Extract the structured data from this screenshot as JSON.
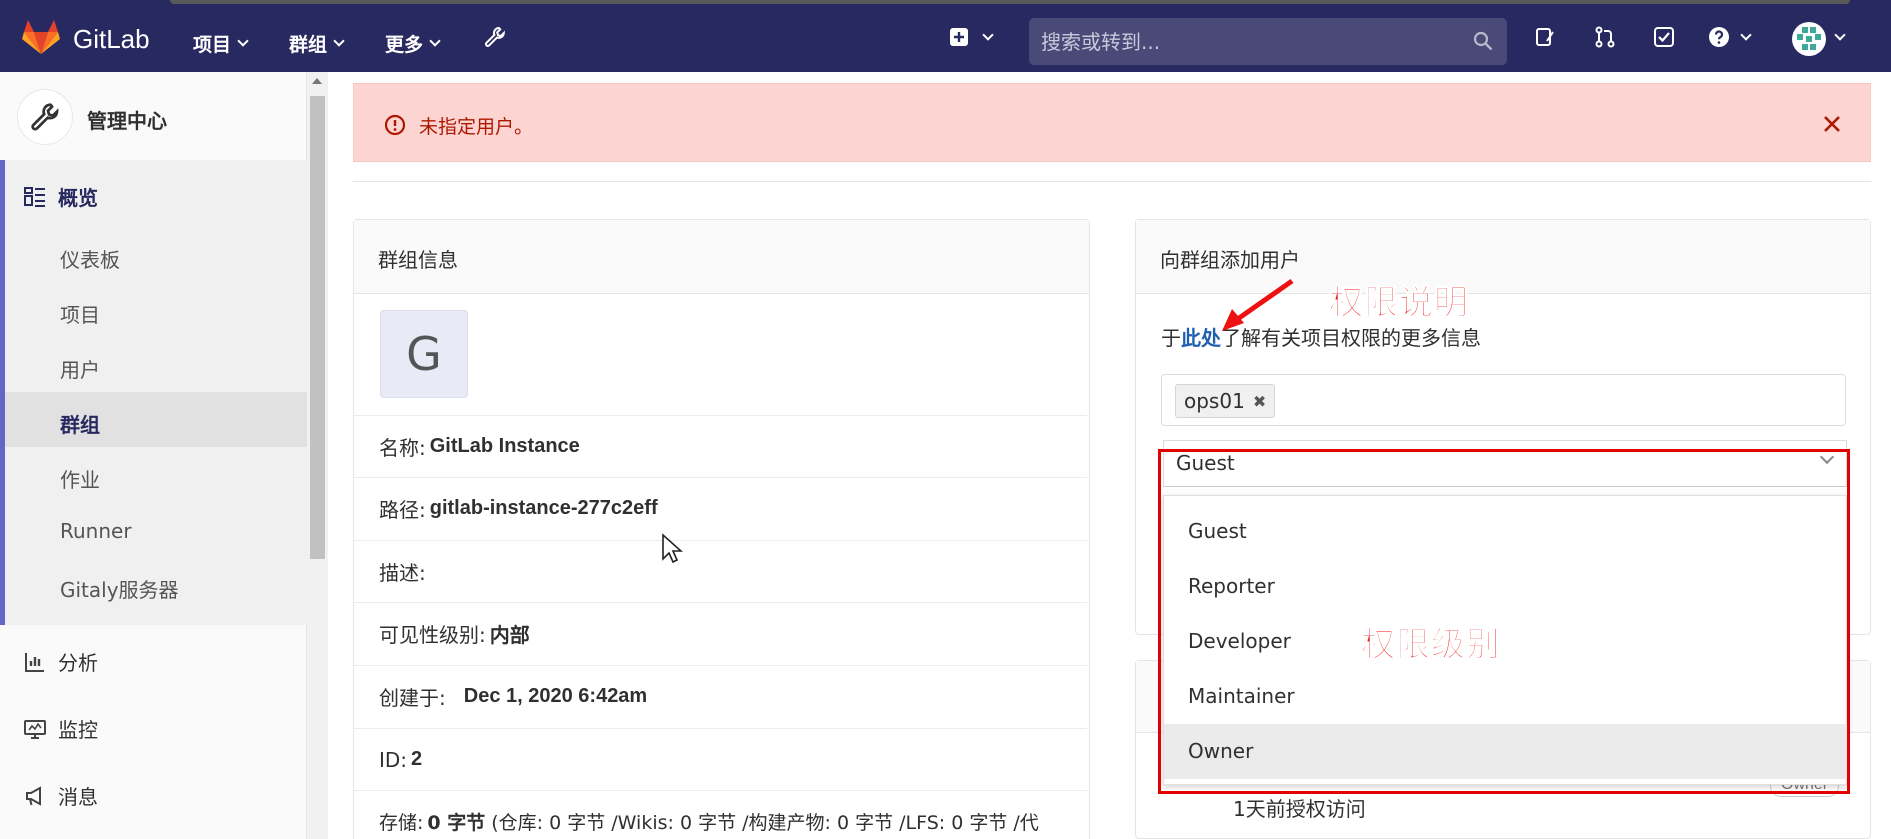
{
  "app": {
    "brand": "GitLab"
  },
  "topnav": {
    "items": [
      {
        "label": "项目"
      },
      {
        "label": "群组"
      },
      {
        "label": "更多"
      }
    ],
    "search_placeholder": "搜索或转到..."
  },
  "sidebar": {
    "title": "管理中心",
    "overview": {
      "label": "概览",
      "items": [
        "仪表板",
        "项目",
        "用户",
        "群组",
        "作业",
        "Runner",
        "Gitaly服务器"
      ]
    },
    "sections": [
      "分析",
      "监控",
      "消息"
    ]
  },
  "alert": {
    "message": "未指定用户。"
  },
  "group_info": {
    "title": "群组信息",
    "avatar_letter": "G",
    "name_label": "名称:",
    "name": "GitLab Instance",
    "path_label": "路径:",
    "path": "gitlab-instance-277c2eff",
    "desc_label": "描述:",
    "visibility_label": "可见性级别:",
    "visibility": "内部",
    "created_label": "创建于:",
    "created": "Dec 1, 2020 6:42am",
    "id_label": "ID:",
    "id": "2",
    "storage_label": "存储:",
    "storage": "0 字节",
    "storage_detail": "(仓库: 0 字节 /Wikis: 0 字节 /构建产物: 0 字节 /LFS: 0 字节 /代"
  },
  "add_user": {
    "title": "向群组添加用户",
    "help_prefix": "于",
    "help_link": "此处",
    "help_suffix": "了解有关项目权限的更多信息",
    "token": "ops01",
    "role_selected": "Guest",
    "roles": [
      "Guest",
      "Reporter",
      "Developer",
      "Maintainer",
      "Owner"
    ],
    "highlighted_role": "Owner"
  },
  "annotations": {
    "permission_note": "权限说明",
    "permission_level": "权限级别"
  },
  "member": {
    "time": "1天前授权访问",
    "badge": "Owner"
  },
  "colors": {
    "topbar": "#292961",
    "alert_bg": "#fcd5d2",
    "alert_text": "#ae1800",
    "annotation": "#ee1111"
  }
}
